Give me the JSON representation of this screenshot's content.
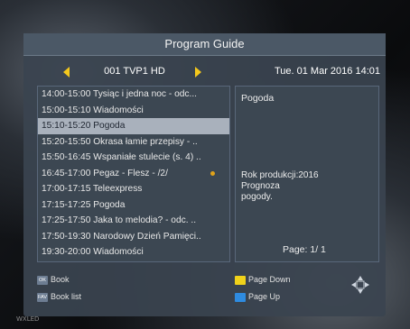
{
  "window": {
    "title": "Program Guide"
  },
  "channel": {
    "name": "001 TVP1 HD",
    "datetime": "Tue. 01 Mar  2016 14:01"
  },
  "schedule": [
    {
      "time": "14:00-15:00",
      "title": "Tysiąc i jedna noc - odc...",
      "selected": false,
      "recording": false
    },
    {
      "time": "15:00-15:10",
      "title": "Wiadomości",
      "selected": false,
      "recording": false
    },
    {
      "time": "15:10-15:20",
      "title": "Pogoda",
      "selected": true,
      "recording": false
    },
    {
      "time": "15:20-15:50",
      "title": "Okrasa łamie przepisy - ..",
      "selected": false,
      "recording": false
    },
    {
      "time": "15:50-16:45",
      "title": "Wspaniałe stulecie (s. 4) ..",
      "selected": false,
      "recording": false
    },
    {
      "time": "16:45-17:00",
      "title": "Pegaz - Flesz - /2/",
      "selected": false,
      "recording": true
    },
    {
      "time": "17:00-17:15",
      "title": "Teleexpress",
      "selected": false,
      "recording": false
    },
    {
      "time": "17:15-17:25",
      "title": "Pogoda",
      "selected": false,
      "recording": false
    },
    {
      "time": "17:25-17:50",
      "title": "Jaka to melodia? - odc. ..",
      "selected": false,
      "recording": false
    },
    {
      "time": "17:50-19:30",
      "title": "Narodowy Dzień Pamięci..",
      "selected": false,
      "recording": false
    },
    {
      "time": "19:30-20:00",
      "title": "Wiadomości",
      "selected": false,
      "recording": false
    }
  ],
  "detail": {
    "title": "Pogoda",
    "description_lines": [
      "Rok produkcji:2016",
      "Prognoza",
      "pogody."
    ],
    "page": "Page:  1/  1"
  },
  "legend": {
    "book": {
      "key": "OK",
      "label": "Book"
    },
    "book_list": {
      "key": "FAV",
      "label": "Book list"
    },
    "page_down": {
      "label": "Page Down",
      "color": "#f0d21a"
    },
    "page_up": {
      "label": "Page Up",
      "color": "#2e8be0"
    }
  },
  "colors": {
    "selection": "#a9b1bc",
    "arrow": "#f4c81c",
    "record_marker": "#e0a21a"
  },
  "corner": {
    "text": "WXLED"
  }
}
